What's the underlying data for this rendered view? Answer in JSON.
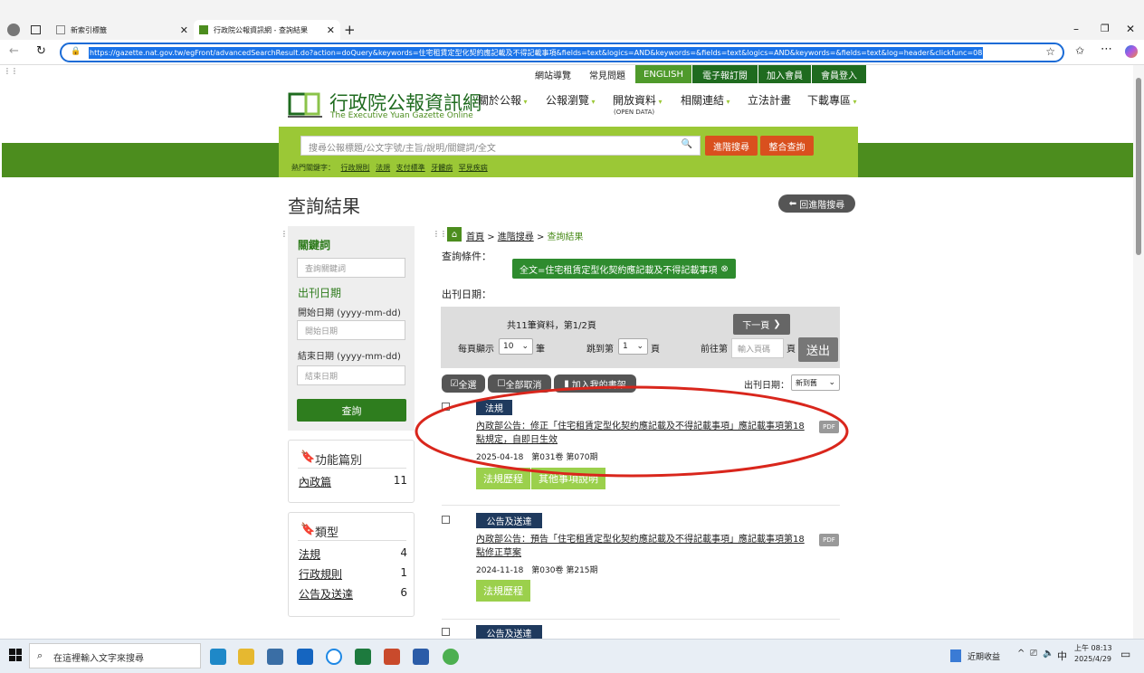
{
  "browser": {
    "tabs": [
      {
        "label": "新索引標籤"
      },
      {
        "label": "行政院公報資訊網 - 查詢結果"
      }
    ],
    "url": "https://gazette.nat.gov.tw/egFront/advancedSearchResult.do?action=doQuery&keywords=住宅租賃定型化契約應記載及不得記載事項&fields=text&logics=AND&keywords=&fields=text&logics=AND&keywords=&fields=text&log=header&clickfunc=08"
  },
  "topnav": {
    "items": [
      "網站導覽",
      "常見問題",
      "ENGLISH",
      "電子報訂閱",
      "加入會員",
      "會員登入"
    ]
  },
  "site": {
    "title_zh": "行政院公報資訊網",
    "title_en": "The Executive Yuan Gazette Online",
    "menu": [
      "關於公報",
      "公報瀏覽",
      "開放資料",
      "相關連結",
      "立法計畫",
      "下載專區"
    ],
    "open_data_sub": "(OPEN DATA)"
  },
  "search": {
    "placeholder": "搜尋公報標題/公文字號/主旨/說明/關鍵詞/全文",
    "advanced_label": "進階搜尋",
    "integrated_label": "整合查詢",
    "hot_label": "熱門關鍵字：",
    "hot_keywords": [
      "行政規則",
      "法規",
      "支付標準",
      "牙體病",
      "罕見疾病"
    ]
  },
  "page": {
    "title": "查詢結果",
    "back_label": "回進階搜尋"
  },
  "sidebar": {
    "keyword_heading": "關鍵詞",
    "keyword_placeholder": "查詢關鍵詞",
    "date_heading": "出刊日期",
    "start_label": "開始日期 (yyyy-mm-dd)",
    "start_placeholder": "開始日期",
    "end_label": "結束日期 (yyyy-mm-dd)",
    "end_placeholder": "結束日期",
    "query_button": "查詢",
    "func_heading": "功能篇別",
    "func_items": [
      {
        "label": "內政篇",
        "count": "11"
      }
    ],
    "type_heading": "類型",
    "type_items": [
      {
        "label": "法規",
        "count": "4"
      },
      {
        "label": "行政規則",
        "count": "1"
      },
      {
        "label": "公告及送達",
        "count": "6"
      }
    ]
  },
  "breadcrumb": [
    "首頁",
    "進階搜尋",
    "查詢結果"
  ],
  "conditions": {
    "label": "查詢條件：",
    "chip": "全文=住宅租賃定型化契約應記載及不得記載事項",
    "date_label": "出刊日期："
  },
  "pager": {
    "summary": "共11筆資料，第1/2頁",
    "next_label": "下一頁",
    "per_page_label": "每頁顯示",
    "per_page_value": "10",
    "per_page_unit": "筆",
    "jump_label": "跳到第",
    "jump_value": "1",
    "jump_unit": "頁",
    "goto_label": "前往第",
    "goto_placeholder": "輸入頁碼",
    "goto_unit": "頁",
    "submit_label": "送出"
  },
  "toolbar": {
    "select_all": "全選",
    "deselect_all": "全部取消",
    "add_bookshelf": "加入我的書架",
    "sort_label": "出刊日期：",
    "sort_value": "新到舊"
  },
  "results": [
    {
      "badge": "法規",
      "title": "內政部公告：修正「住宅租賃定型化契約應記載及不得記載事項」應記載事項第18點規定，自即日生效",
      "meta": "2025-04-18　第031卷 第070期",
      "buttons": [
        "法規歷程",
        "其他事項說明"
      ],
      "pdf": "PDF"
    },
    {
      "badge": "公告及送達",
      "title": "內政部公告：預告「住宅租賃定型化契約應記載及不得記載事項」應記載事項第18點修正草案",
      "meta": "2024-11-18　第030卷 第215期",
      "buttons": [
        "法規歷程"
      ],
      "pdf": "PDF"
    },
    {
      "badge": "公告及送達"
    }
  ],
  "taskbar": {
    "search_placeholder": "在這裡輸入文字來搜尋",
    "news_label": "近期收益",
    "ime": "中",
    "time_period": "上午 08:13",
    "date": "2025/4/29"
  },
  "colors": {
    "brand_green": "#4c8d1e",
    "panel_green": "#9bc836",
    "orange": "#d9501e",
    "annotation_red": "#d9261c"
  }
}
